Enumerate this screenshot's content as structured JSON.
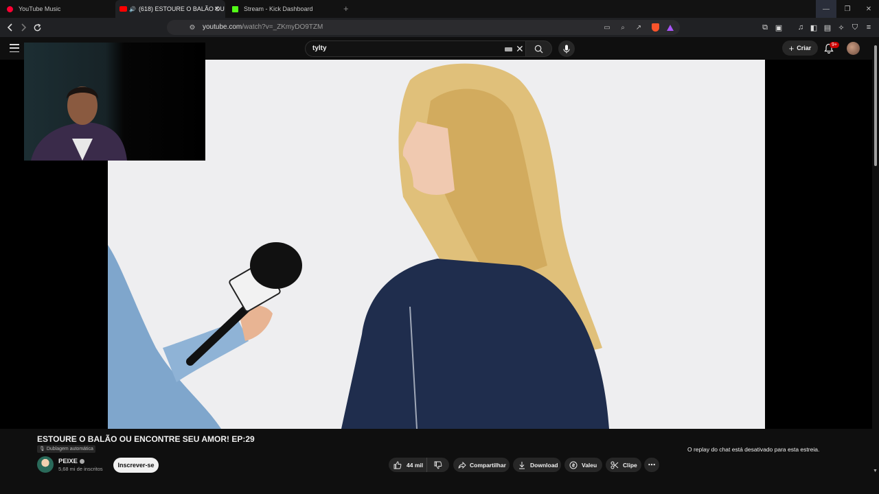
{
  "browser": {
    "tabs": [
      {
        "label": "YouTube Music"
      },
      {
        "label": "(618) ESTOURE O BALÃO OU"
      },
      {
        "label": "Stream - Kick Dashboard"
      }
    ],
    "url_host": "youtube.com",
    "url_path": "/watch?v=_ZKmyDO9TZM"
  },
  "youtube": {
    "search_query": "tylty",
    "create_label": "Criar",
    "notification_count": "9+"
  },
  "video": {
    "title": "ESTOURE O BALÃO OU ENCONTRE SEU AMOR! EP:29",
    "dub_badge": "Dublagem automática",
    "channel_name": "PEIXE",
    "subscribers": "5,68 mi de inscritos",
    "subscribe_label": "Inscrever-se",
    "like_count": "44 mil",
    "share_label": "Compartilhar",
    "download_label": "Download",
    "thanks_label": "Valeu",
    "clip_label": "Clipe"
  },
  "chat": {
    "replay_disabled": "O replay do chat está desativado para esta estreia."
  },
  "colors": {
    "background": "#0f0f0f",
    "accent_red": "#ff0000",
    "kick_green": "#53fc18"
  }
}
